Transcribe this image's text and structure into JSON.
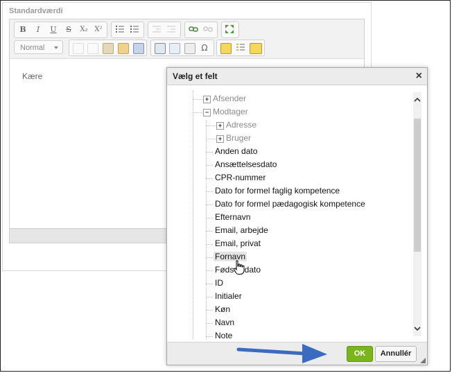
{
  "page": {
    "field_label": "Standardværdi",
    "editor_text": "Kære"
  },
  "toolbar": {
    "format_value": "Normal",
    "bold": "B",
    "italic": "I",
    "underline": "U",
    "strike": "S",
    "subscript": "X₂",
    "superscript": "X²",
    "omega": "Ω"
  },
  "dialog": {
    "title": "Vælg et felt",
    "close": "×",
    "ok_label": "OK",
    "cancel_label": "Annullér",
    "tree": {
      "afsender": "Afsender",
      "modtager": "Modtager",
      "adresse": "Adresse",
      "bruger": "Bruger",
      "items": [
        "Anden dato",
        "Ansættelsesdato",
        "CPR-nummer",
        "Dato for formel faglig kompetence",
        "Dato for formel pædagogisk kompetence",
        "Efternavn",
        "Email, arbejde",
        "Email, privat",
        "Fornavn",
        "Fødselsdato",
        "ID",
        "Initialer",
        "Køn",
        "Navn",
        "Note"
      ],
      "selected": "Fornavn"
    }
  },
  "colors": {
    "ok_green": "#7ab51d",
    "annotation_blue": "#3a6bbf"
  }
}
